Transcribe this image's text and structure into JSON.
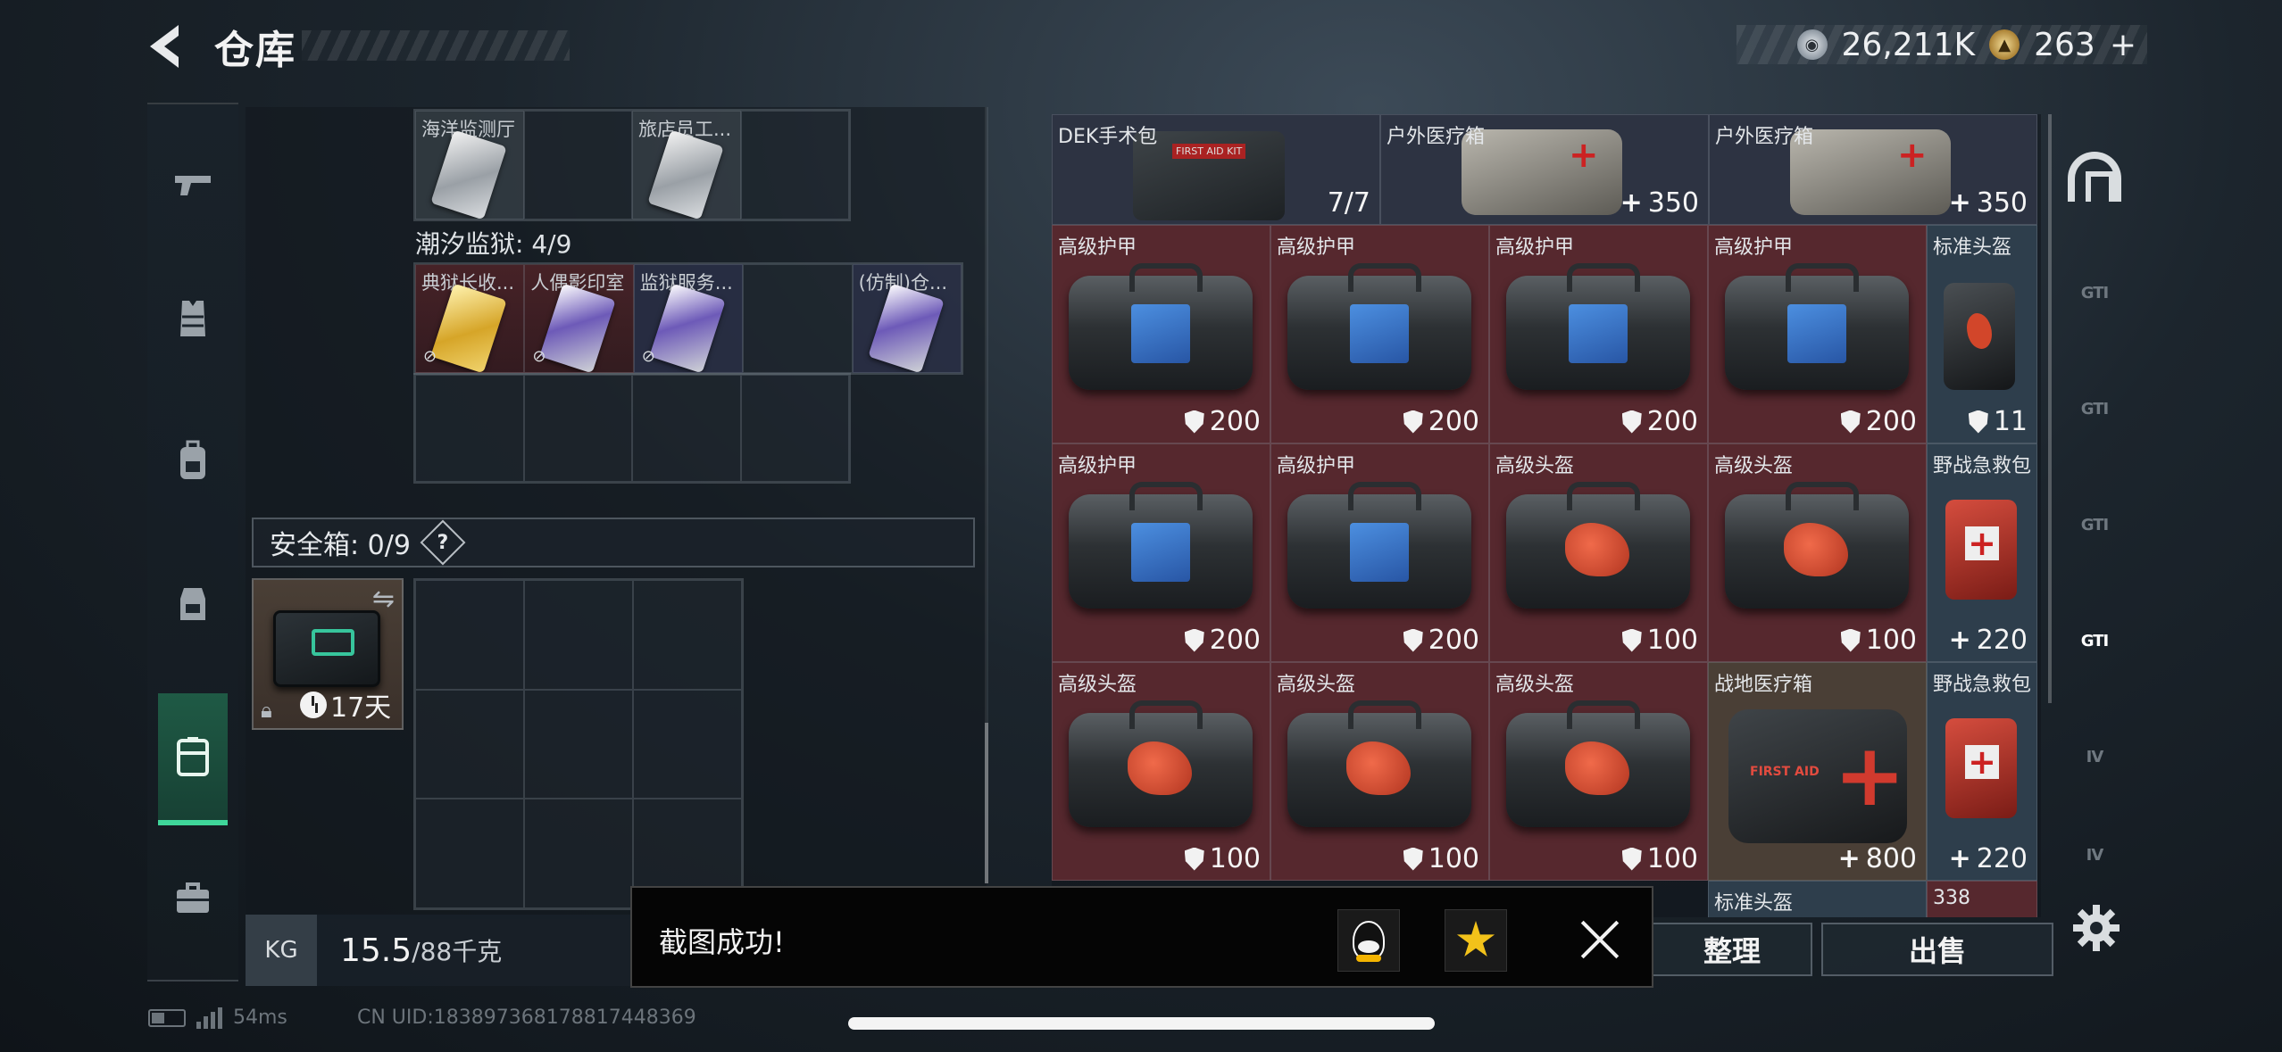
{
  "header": {
    "title": "仓库",
    "silver": "26,211K",
    "gold": "263",
    "gold_plus": "+"
  },
  "sidebar": {
    "items": [
      "weapons",
      "armor",
      "backpack",
      "rig",
      "storage",
      "tools"
    ],
    "active": "storage"
  },
  "inventory": {
    "top_labels": [
      "海洋监测厅",
      "旅店员工..."
    ],
    "section_title": "潮汐监狱: 4/9",
    "cards": [
      "典狱长收...",
      "人偶影印室",
      "监狱服务...",
      "(仿制)仓..."
    ],
    "safe_label": "安全箱: 0/9",
    "help": "?",
    "safe_timer": "17天",
    "weight_value": "15.5",
    "weight_max": "/88千克"
  },
  "stash": {
    "row1": [
      {
        "name": "DEK手术包",
        "value": "7/7"
      },
      {
        "name": "户外医疗箱",
        "value": "350"
      },
      {
        "name": "户外医疗箱",
        "value": "350"
      }
    ],
    "grid": [
      {
        "name": "高级护甲",
        "value": "200"
      },
      {
        "name": "高级护甲",
        "value": "200"
      },
      {
        "name": "高级护甲",
        "value": "200"
      },
      {
        "name": "高级护甲",
        "value": "200"
      },
      {
        "name": "标准头盔",
        "value": "11"
      },
      {
        "name": "高级护甲",
        "value": "200"
      },
      {
        "name": "高级护甲",
        "value": "200"
      },
      {
        "name": "高级头盔",
        "value": "100"
      },
      {
        "name": "高级头盔",
        "value": "100"
      },
      {
        "name": "野战急救包",
        "value": "220"
      },
      {
        "name": "高级头盔",
        "value": "100"
      },
      {
        "name": "高级头盔",
        "value": "100"
      },
      {
        "name": "高级头盔",
        "value": "100"
      },
      {
        "name": "战地医疗箱",
        "value": "800"
      },
      {
        "name": "野战急救包",
        "value": "220"
      }
    ],
    "partial_bottom": [
      "标准头盔",
      "338"
    ]
  },
  "rail": {
    "labels": [
      "GTI",
      "GTI",
      "GTI",
      "GTI",
      "IV",
      "IV"
    ]
  },
  "actions": {
    "sort": "整理",
    "sell": "出售"
  },
  "toast": {
    "message": "截图成功!"
  },
  "footer": {
    "ping": "54ms",
    "uid": "CN UID:1838973681788174483​69"
  },
  "colors": {
    "armor_cell": "#5a2a30",
    "med_cell": "#2e3e4c",
    "accent": "#3fd69a"
  }
}
